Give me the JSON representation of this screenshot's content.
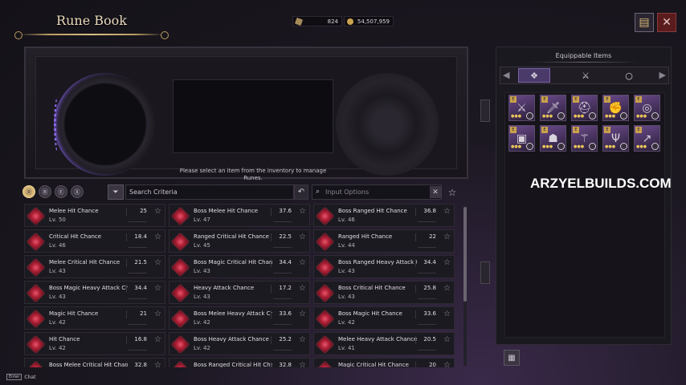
{
  "header": {
    "title": "Rune Book"
  },
  "currency": {
    "a_value": "824",
    "b_value": "54,507,959"
  },
  "rune_frame": {
    "hint": "Please select an item from the inventory to manage Runes."
  },
  "filters": {
    "tabs": [
      "Ⓡ",
      "Ⓑ",
      "Ⓔ",
      "Ⓧ"
    ],
    "search_label": "Search Criteria",
    "options_placeholder": "Input Options"
  },
  "runes": [
    {
      "name": "Melee Hit Chance",
      "level": "Lv. 50",
      "value": "25"
    },
    {
      "name": "Boss Melee Hit Chance",
      "level": "Lv. 47",
      "value": "37.6"
    },
    {
      "name": "Boss Ranged Hit Chance",
      "level": "Lv. 46",
      "value": "36.8"
    },
    {
      "name": "Critical Hit Chance",
      "level": "Lv. 46",
      "value": "18.4"
    },
    {
      "name": "Ranged Critical Hit Chance",
      "level": "Lv. 45",
      "value": "22.5"
    },
    {
      "name": "Ranged Hit Chance",
      "level": "Lv. 44",
      "value": "22"
    },
    {
      "name": "Melee Critical Hit Chance",
      "level": "Lv. 43",
      "value": "21.5"
    },
    {
      "name": "Boss Magic Critical Hit Chance",
      "level": "Lv. 43",
      "value": "34.4"
    },
    {
      "name": "Boss Ranged Heavy Attack C",
      "level": "Lv. 43",
      "value": "34.4"
    },
    {
      "name": "Boss Magic Heavy Attack Ch",
      "level": "Lv. 43",
      "value": "34.4"
    },
    {
      "name": "Heavy Attack Chance",
      "level": "Lv. 43",
      "value": "17.2"
    },
    {
      "name": "Boss Critical Hit Chance",
      "level": "Lv. 43",
      "value": "25.8"
    },
    {
      "name": "Magic Hit Chance",
      "level": "Lv. 42",
      "value": "21"
    },
    {
      "name": "Boss Melee Heavy Attack Ch",
      "level": "Lv. 42",
      "value": "33.6"
    },
    {
      "name": "Boss Magic Hit Chance",
      "level": "Lv. 42",
      "value": "33.6"
    },
    {
      "name": "Hit Chance",
      "level": "Lv. 42",
      "value": "16.8"
    },
    {
      "name": "Boss Heavy Attack Chance",
      "level": "Lv. 42",
      "value": "25.2"
    },
    {
      "name": "Melee Heavy Attack Chance",
      "level": "Lv. 41",
      "value": "20.5"
    },
    {
      "name": "Boss Melee Critical Hit Chan",
      "level": "",
      "value": "32.8"
    },
    {
      "name": "Boss Ranged Critical Hit Chan",
      "level": "",
      "value": "32.8"
    },
    {
      "name": "Magic Critical Hit Chance",
      "level": "",
      "value": "20"
    }
  ],
  "equippable": {
    "title": "Equippable Items",
    "items": [
      {
        "icon": "crossbow-icon",
        "glyph": "⚔"
      },
      {
        "icon": "sword-icon",
        "glyph": "🗡"
      },
      {
        "icon": "helmet-icon",
        "glyph": "⛑"
      },
      {
        "icon": "gauntlet-icon",
        "glyph": "✊"
      },
      {
        "icon": "bracelet-icon",
        "glyph": "◎"
      },
      {
        "icon": "bracer-icon",
        "glyph": "▣"
      },
      {
        "icon": "mask-icon",
        "glyph": "☗"
      },
      {
        "icon": "staff-icon",
        "glyph": "⚚"
      },
      {
        "icon": "trident-icon",
        "glyph": "Ψ"
      },
      {
        "icon": "spear-icon",
        "glyph": "↗"
      }
    ]
  },
  "watermark": "ARZYELBUILDS.COM",
  "chat": {
    "key": "Enter",
    "label": "Chat"
  }
}
